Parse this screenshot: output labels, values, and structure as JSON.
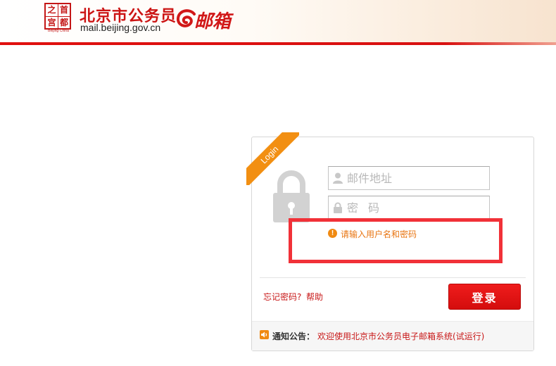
{
  "header": {
    "seal_chars": [
      "之",
      "首",
      "都",
      "宫"
    ],
    "seal_caption": "Beijing·China",
    "site_title": "北京市公务员",
    "site_domain": "mail.beijing.gov.cn",
    "mail_logo_text": "邮箱"
  },
  "login": {
    "ribbon_label": "Login",
    "username_placeholder": "邮件地址",
    "password_placeholder": "密码",
    "error_icon": "!",
    "error_message": "请输入用户名和密码",
    "forgot_label": "忘记密码?",
    "help_label": "帮助",
    "submit_label": "登录"
  },
  "notice": {
    "label": "通知公告：",
    "text": "欢迎使用北京市公务员电子邮箱系统(试运行)"
  },
  "colors": {
    "brand_red": "#cc1414",
    "accent_orange": "#f28f12",
    "highlight_red": "#f13138"
  },
  "icons": {
    "lock": "lock-icon",
    "user": "user-icon",
    "password": "padlock-icon",
    "error": "warning-icon",
    "notice": "speaker-icon"
  }
}
